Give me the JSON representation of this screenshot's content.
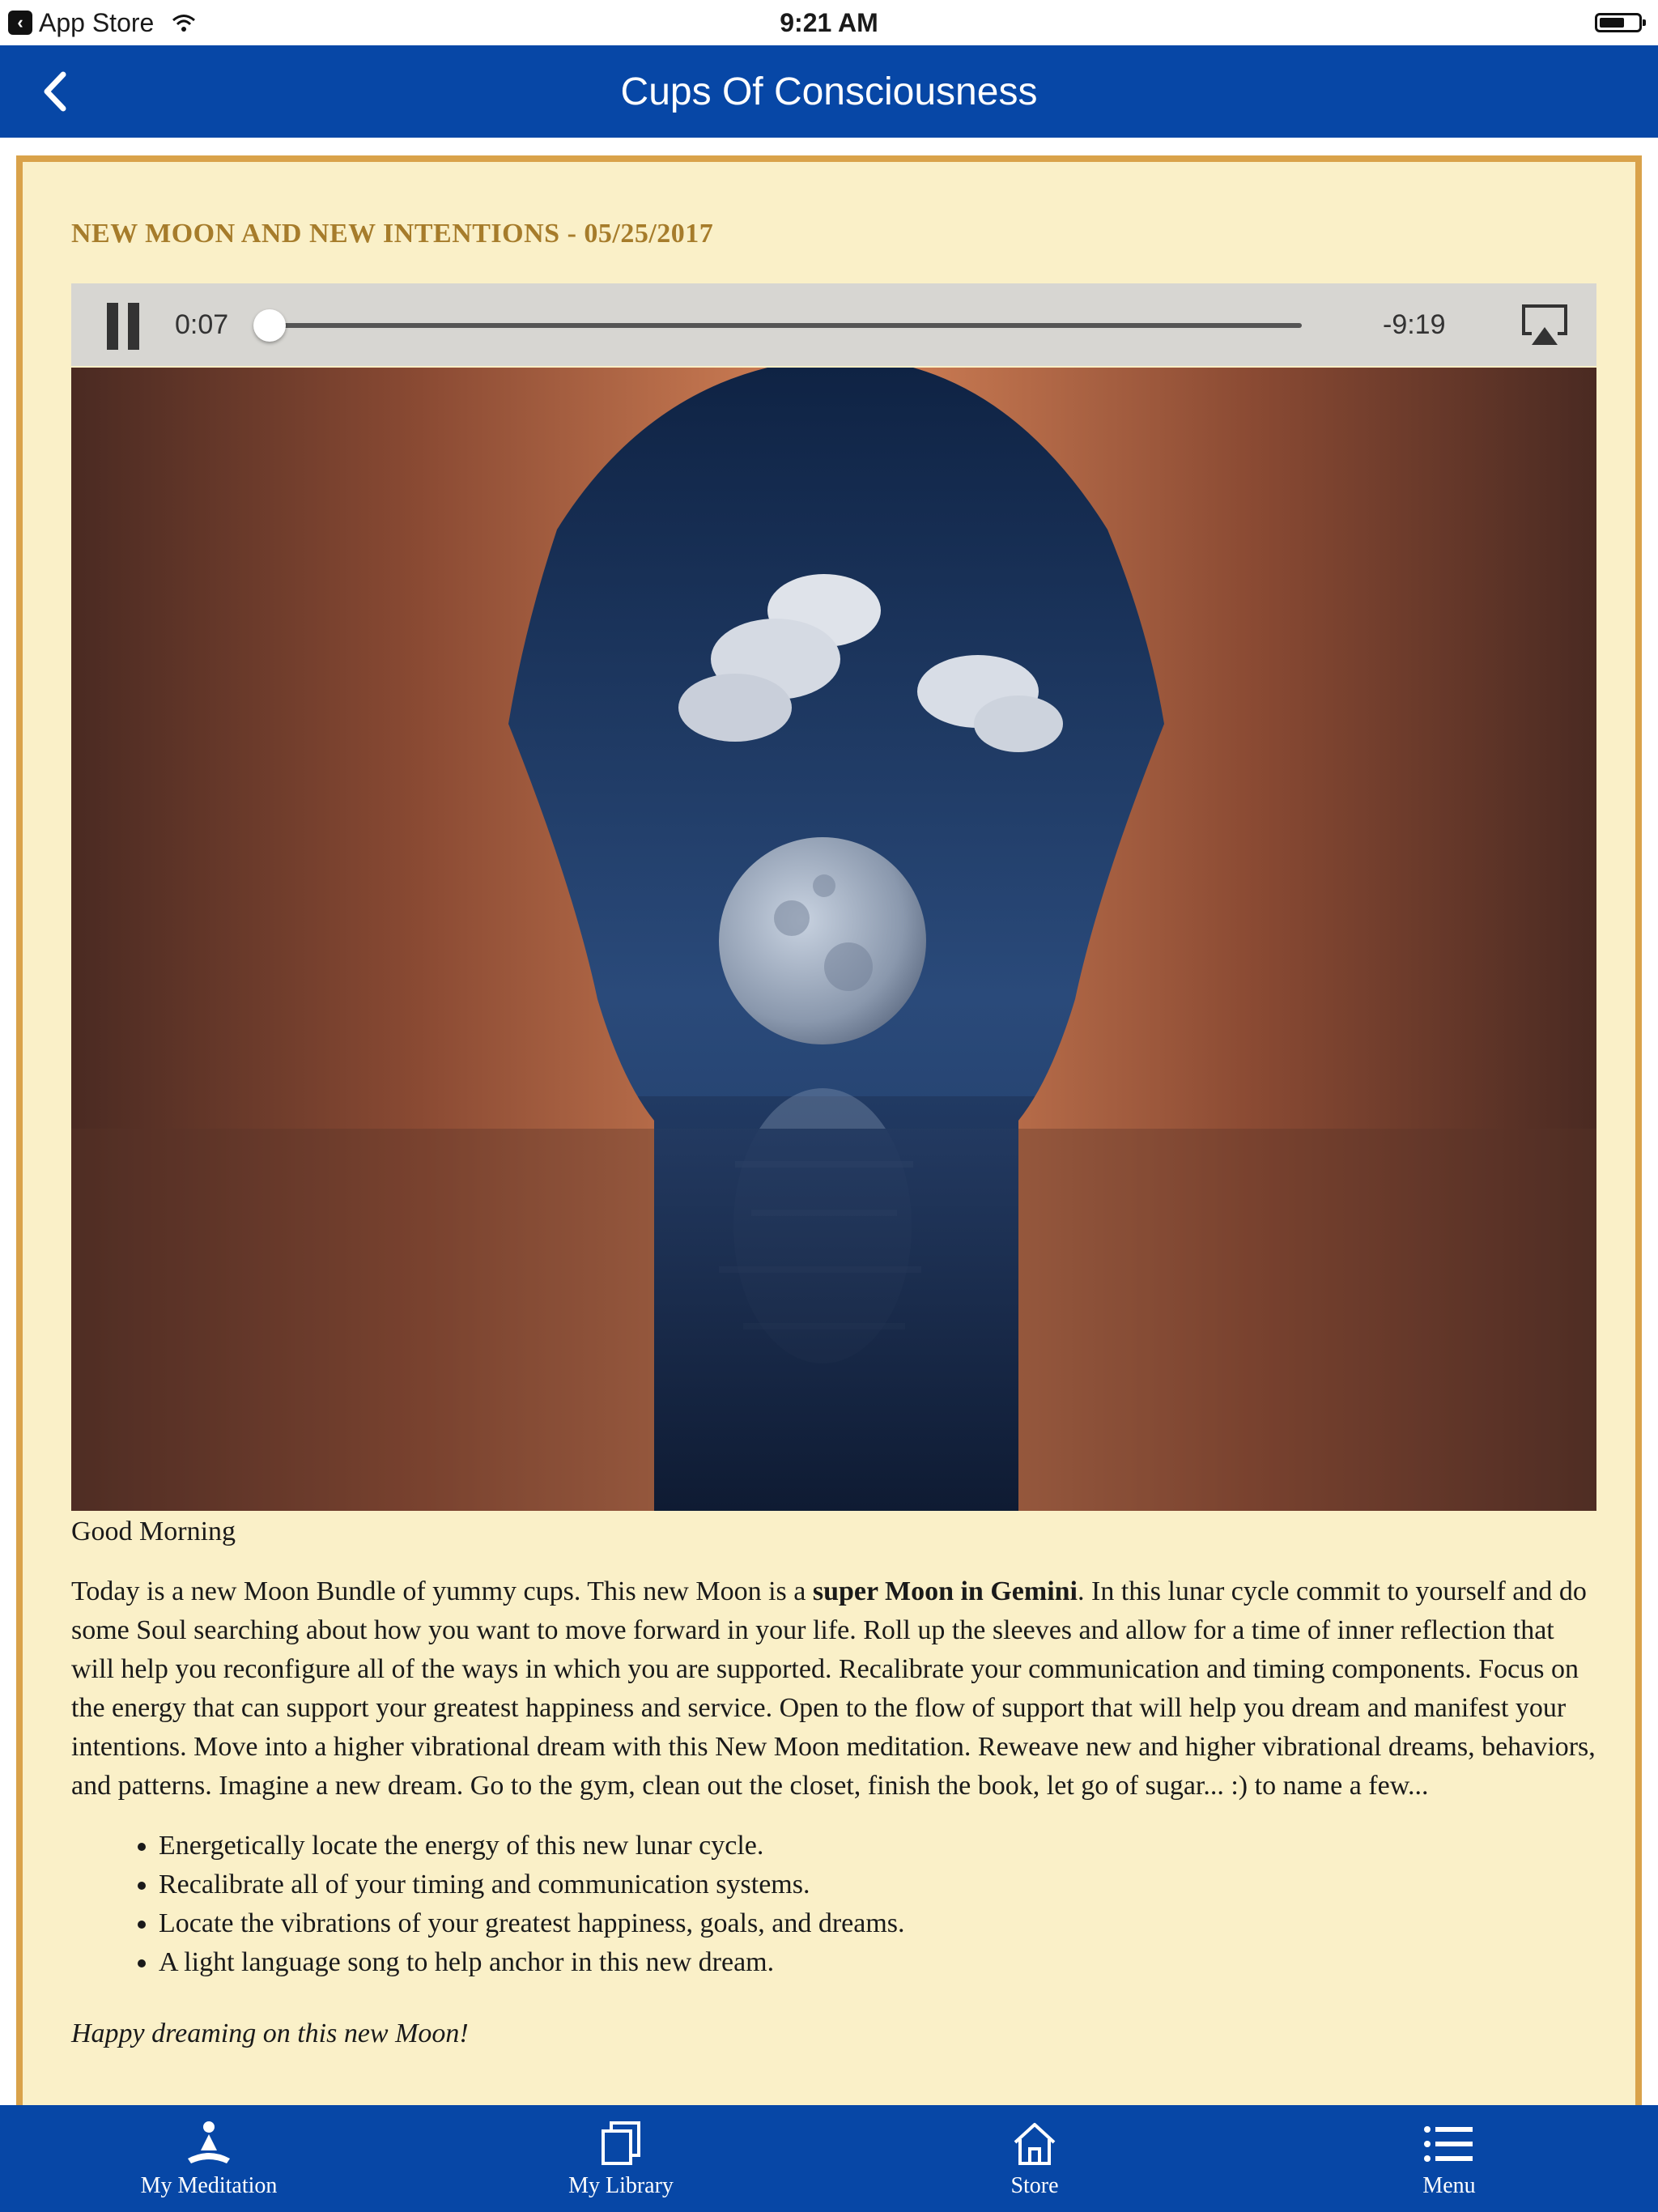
{
  "status_bar": {
    "back_app_label": "App Store",
    "time": "9:21 AM"
  },
  "nav": {
    "title": "Cups Of Consciousness"
  },
  "episode": {
    "title": "NEW MOON AND NEW INTENTIONS - 05/25/2017"
  },
  "player": {
    "elapsed": "0:07",
    "remaining": "-9:19",
    "progress": 0.012
  },
  "article": {
    "greeting": "Good Morning",
    "intro_before": "Today is a new Moon Bundle of yummy cups. This new Moon is a ",
    "intro_bold": "super Moon in Gemini",
    "intro_after": ". In this lunar cycle commit to yourself and do some Soul searching about how you want to move forward in your life. Roll up the sleeves and allow for a time of inner reflection that will help you reconfigure all of the ways in which you are supported. Recalibrate your communication and timing components. Focus on the energy that can support your greatest happiness and service. Open to the flow of support that will help you dream and manifest your intentions. Move into a higher vibrational dream with this New Moon meditation. Reweave new and higher vibrational dreams, behaviors, and patterns. Imagine a new dream. Go to the gym, clean out the closet, finish the book, let go of sugar... :) to name a few...",
    "bullets": [
      "Energetically locate the energy of this new lunar cycle.",
      "Recalibrate all of your timing and communication systems.",
      "Locate the vibrations of your greatest happiness, goals, and dreams.",
      "A light language song to help anchor in this new dream."
    ],
    "closing": "Happy dreaming on this new Moon!"
  },
  "tabs": [
    {
      "label": "My Meditation",
      "icon": "meditation-icon"
    },
    {
      "label": "My Library",
      "icon": "library-icon"
    },
    {
      "label": "Store",
      "icon": "home-icon"
    },
    {
      "label": "Menu",
      "icon": "menu-icon"
    }
  ],
  "colors": {
    "nav_blue": "#0747a6",
    "frame_gold": "#d9a24a",
    "content_bg": "#faf0c8",
    "title_gold": "#a67c2b"
  }
}
